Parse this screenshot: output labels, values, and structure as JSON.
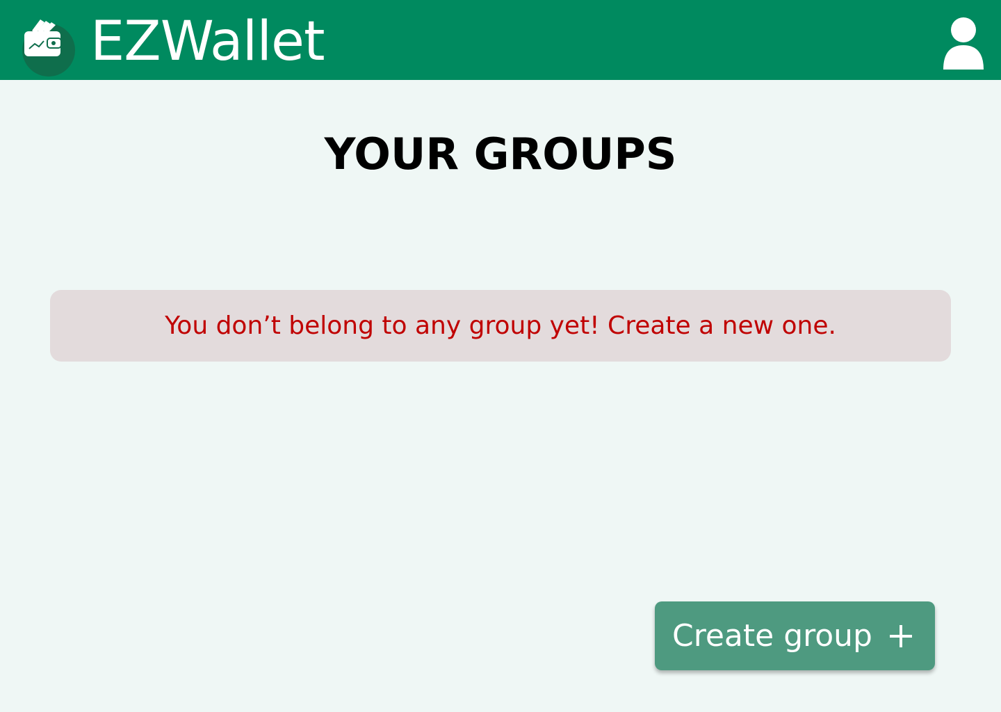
{
  "header": {
    "app_title": "EZWallet",
    "logo_icon": "wallet-icon",
    "profile_icon": "user-profile-icon",
    "color": "#008a5f"
  },
  "main": {
    "page_title": "YOUR GROUPS",
    "empty_message": "You don’t belong to any group yet! Create a new one.",
    "empty_message_color": "#c00000",
    "empty_message_background": "#e3dbdc"
  },
  "actions": {
    "create_group_label": "Create group",
    "create_group_icon": "plus-icon",
    "create_group_color": "#4e9a80"
  },
  "colors": {
    "background": "#eff7f5"
  }
}
